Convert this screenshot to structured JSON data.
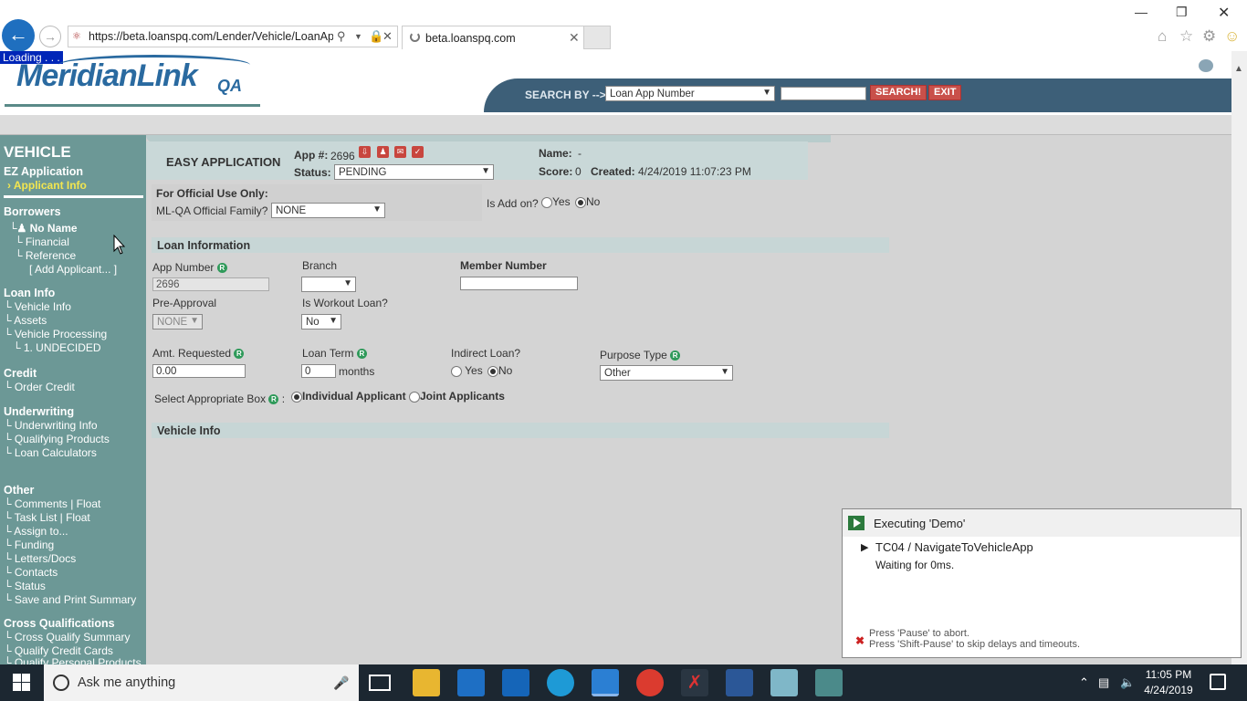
{
  "browser": {
    "url": "https://beta.loanspq.com/Lender/Vehicle/LoanApp",
    "tab_title": "beta.loanspq.com",
    "loading_text": "Loading . . ."
  },
  "header": {
    "logo": "MeridianLink",
    "logo_suffix": "QA",
    "search_by_label": "SEARCH BY -->",
    "search_by_value": "Loan App Number",
    "search_button": "SEARCH!",
    "exit_button": "EXIT"
  },
  "sidebar": {
    "title": "VEHICLE",
    "ez_app": "EZ Application",
    "applicant_info": "Applicant Info",
    "borrowers": "Borrowers",
    "no_name": "No Name",
    "financial": "Financial",
    "reference": "Reference",
    "add_applicant": "[ Add Applicant... ]",
    "loan_info": "Loan Info",
    "vehicle_info": "Vehicle Info",
    "assets": "Assets",
    "vehicle_processing": "Vehicle Processing",
    "undecided": "1. UNDECIDED",
    "credit": "Credit",
    "order_credit": "Order Credit",
    "underwriting": "Underwriting",
    "underwriting_info": "Underwriting Info",
    "qualifying_products": "Qualifying Products",
    "loan_calculators": "Loan Calculators",
    "other": "Other",
    "comments": "Comments | Float",
    "task_list": "Task List | Float",
    "assign_to": "Assign to...",
    "funding": "Funding",
    "letters_docs": "Letters/Docs",
    "contacts": "Contacts",
    "status": "Status",
    "save_print": "Save and Print Summary",
    "cross_qual": "Cross Qualifications",
    "cross_qual_summary": "Cross Qualify Summary",
    "qualify_credit_cards": "Qualify Credit Cards",
    "qualify_personal": "Qualify Personal Products"
  },
  "app_header": {
    "title": "EASY APPLICATION",
    "app_no_label": "App #:",
    "app_no": "2696",
    "status_label": "Status:",
    "status_value": "PENDING",
    "name_label": "Name:",
    "name_value": "-",
    "score_label": "Score:",
    "score_value": "0",
    "created_label": "Created:",
    "created_value": "4/24/2019 11:07:23 PM"
  },
  "official": {
    "title": "For Official Use Only:",
    "family_label": "ML-QA Official Family?",
    "family_value": "NONE",
    "addon_label": "Is Add on?",
    "yes": "Yes",
    "no": "No"
  },
  "loan_info": {
    "section_title": "Loan Information",
    "app_number_label": "App Number",
    "app_number_value": "2696",
    "branch_label": "Branch",
    "member_number_label": "Member Number",
    "preapproval_label": "Pre-Approval",
    "preapproval_value": "NONE",
    "workout_label": "Is Workout Loan?",
    "workout_value": "No",
    "amt_label": "Amt. Requested",
    "amt_value": "0.00",
    "term_label": "Loan Term",
    "term_value": "0",
    "term_unit": "months",
    "indirect_label": "Indirect Loan?",
    "indirect_yes": "Yes",
    "indirect_no": "No",
    "purpose_label": "Purpose Type",
    "purpose_value": "Other",
    "box_label": "Select Appropriate Box",
    "individual": "Individual Applicant",
    "joint": "Joint Applicants",
    "vehicle_section": "Vehicle Info"
  },
  "exec_panel": {
    "title": "Executing 'Demo'",
    "step": "TC04 / NavigateToVehicleApp",
    "wait": "Waiting for 0ms.",
    "hint1": "Press 'Pause' to abort.",
    "hint2": "Press 'Shift-Pause' to skip delays and timeouts."
  },
  "taskbar": {
    "search_placeholder": "Ask me anything",
    "time": "11:05 PM",
    "date": "4/24/2019"
  }
}
